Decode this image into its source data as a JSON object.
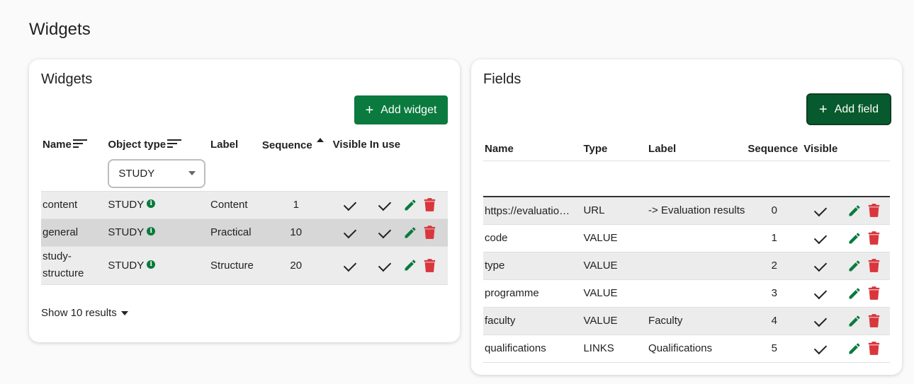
{
  "page": {
    "title": "Widgets"
  },
  "widgets_card": {
    "title": "Widgets",
    "add_button": "Add widget",
    "columns": [
      "Name",
      "Object type",
      "Label",
      "Sequence",
      "Visible",
      "In use"
    ],
    "filter": {
      "object_type_selected": "STUDY"
    },
    "rows": [
      {
        "name": "content",
        "object_type": "STUDY",
        "label": "Content",
        "sequence": "1",
        "visible": true,
        "in_use": true
      },
      {
        "name": "general",
        "object_type": "STUDY",
        "label": "Practical",
        "sequence": "10",
        "visible": true,
        "in_use": true
      },
      {
        "name_line1": "study-",
        "name_line2": "structure",
        "object_type": "STUDY",
        "label": "Structure",
        "sequence": "20",
        "visible": true,
        "in_use": true
      }
    ],
    "show_results": "Show 10 results"
  },
  "fields_card": {
    "title": "Fields",
    "add_button": "Add field",
    "columns": [
      "Name",
      "Type",
      "Label",
      "Sequence",
      "Visible"
    ],
    "rows": [
      {
        "name": "https://evaluatio…",
        "type": "URL",
        "label": "-> Evaluation results",
        "sequence": "0"
      },
      {
        "name": "code",
        "type": "VALUE",
        "label": "",
        "sequence": "1"
      },
      {
        "name": "type",
        "type": "VALUE",
        "label": "",
        "sequence": "2"
      },
      {
        "name": "programme",
        "type": "VALUE",
        "label": "",
        "sequence": "3"
      },
      {
        "name": "faculty",
        "type": "VALUE",
        "label": "Faculty",
        "sequence": "4"
      },
      {
        "name": "qualifications",
        "type": "LINKS",
        "label": "Qualifications",
        "sequence": "5"
      }
    ]
  },
  "icons": {
    "info": "info-icon",
    "edit": "pencil-icon",
    "delete": "trash-icon",
    "check": "check-icon",
    "sort": "sort-lines-icon",
    "sort_asc": "sort-ascending-icon"
  },
  "colors": {
    "primary": "#0a7a3e",
    "danger": "#d9363e",
    "row_stripe": "#ececec",
    "row_highlight": "#d7d7d7"
  }
}
